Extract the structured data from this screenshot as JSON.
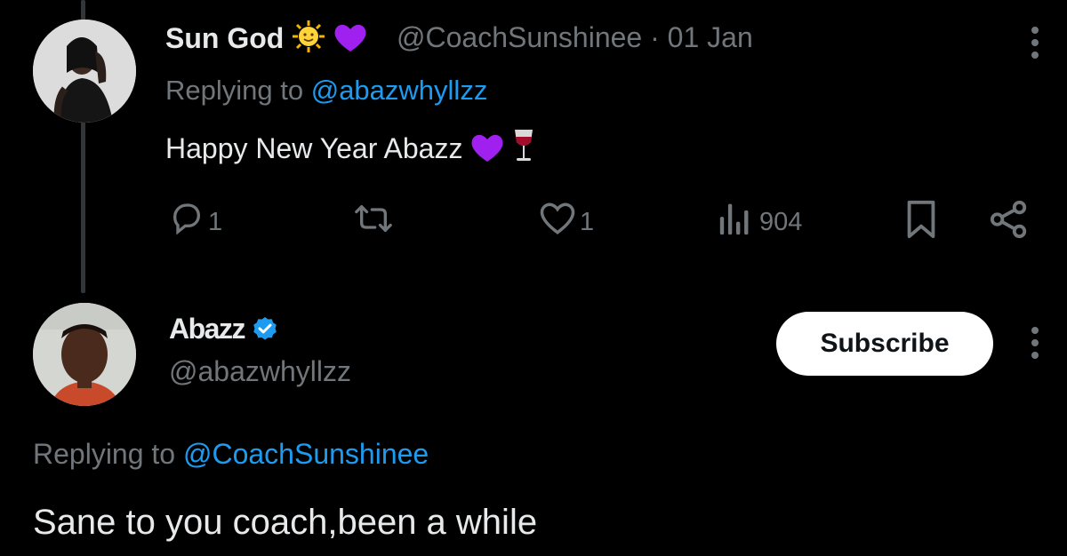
{
  "reply_tweet": {
    "display_name": "Sun God",
    "name_emojis": [
      "sun-face-icon",
      "purple-heart-icon"
    ],
    "handle": "@CoachSunshinee",
    "separator": "·",
    "date": "01 Jan",
    "replying_prefix": "Replying to",
    "replying_handle": "@abazwhyllzz",
    "text": "Happy New Year Abazz",
    "text_emojis": [
      "purple-heart-icon",
      "wine-glass-icon"
    ],
    "reply_count": "1",
    "like_count": "1",
    "view_count": "904"
  },
  "main_tweet": {
    "display_name": "Abazz",
    "verified": true,
    "handle": "@abazwhyllzz",
    "subscribe_label": "Subscribe",
    "replying_prefix": "Replying to",
    "replying_handle": "@CoachSunshinee",
    "text": "Sane to you coach,been a while"
  },
  "colors": {
    "background": "#000000",
    "primary_text": "#e7e9ea",
    "secondary_text": "#71767b",
    "link": "#1d9bf0",
    "thread_line": "#333639"
  }
}
